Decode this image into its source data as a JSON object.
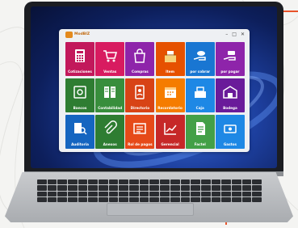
{
  "app": {
    "logo_text": "ModBIZ",
    "window_controls": {
      "minimize": "–",
      "maximize": "□",
      "close": "✕"
    }
  },
  "tiles": [
    {
      "label": "Cotizaciones",
      "color": "#c2185b",
      "icon": "calculator-icon"
    },
    {
      "label": "Ventas",
      "color": "#d81b60",
      "icon": "shopping-cart-icon"
    },
    {
      "label": "Compras",
      "color": "#8e24aa",
      "icon": "shopping-bag-icon"
    },
    {
      "label": "Item",
      "color": "#e65100",
      "icon": "boxes-icon"
    },
    {
      "label": "por cobrar",
      "color": "#1976d2",
      "icon": "receive-hand-icon"
    },
    {
      "label": "por pagar",
      "color": "#8e24aa",
      "icon": "pay-hand-icon"
    },
    {
      "label": "Bancos",
      "color": "#2e7d32",
      "icon": "safe-icon"
    },
    {
      "label": "Contabilidad",
      "color": "#388e3c",
      "icon": "ledger-icon"
    },
    {
      "label": "Directorio",
      "color": "#d84315",
      "icon": "directory-icon"
    },
    {
      "label": "Recordatorio",
      "color": "#f57c00",
      "icon": "calendar-icon"
    },
    {
      "label": "Caja",
      "color": "#1e88e5",
      "icon": "cash-register-icon"
    },
    {
      "label": "Bodega",
      "color": "#6a1b9a",
      "icon": "warehouse-icon"
    },
    {
      "label": "Auditoria",
      "color": "#1565c0",
      "icon": "audit-icon"
    },
    {
      "label": "Anexos",
      "color": "#2e7d32",
      "icon": "attachment-icon"
    },
    {
      "label": "Rol de pagos",
      "color": "#e64a19",
      "icon": "payroll-icon"
    },
    {
      "label": "Gerencial",
      "color": "#c62828",
      "icon": "chart-icon"
    },
    {
      "label": "Factel",
      "color": "#43a047",
      "icon": "invoice-icon"
    },
    {
      "label": "Gastos",
      "color": "#1e88e5",
      "icon": "expenses-icon"
    }
  ]
}
